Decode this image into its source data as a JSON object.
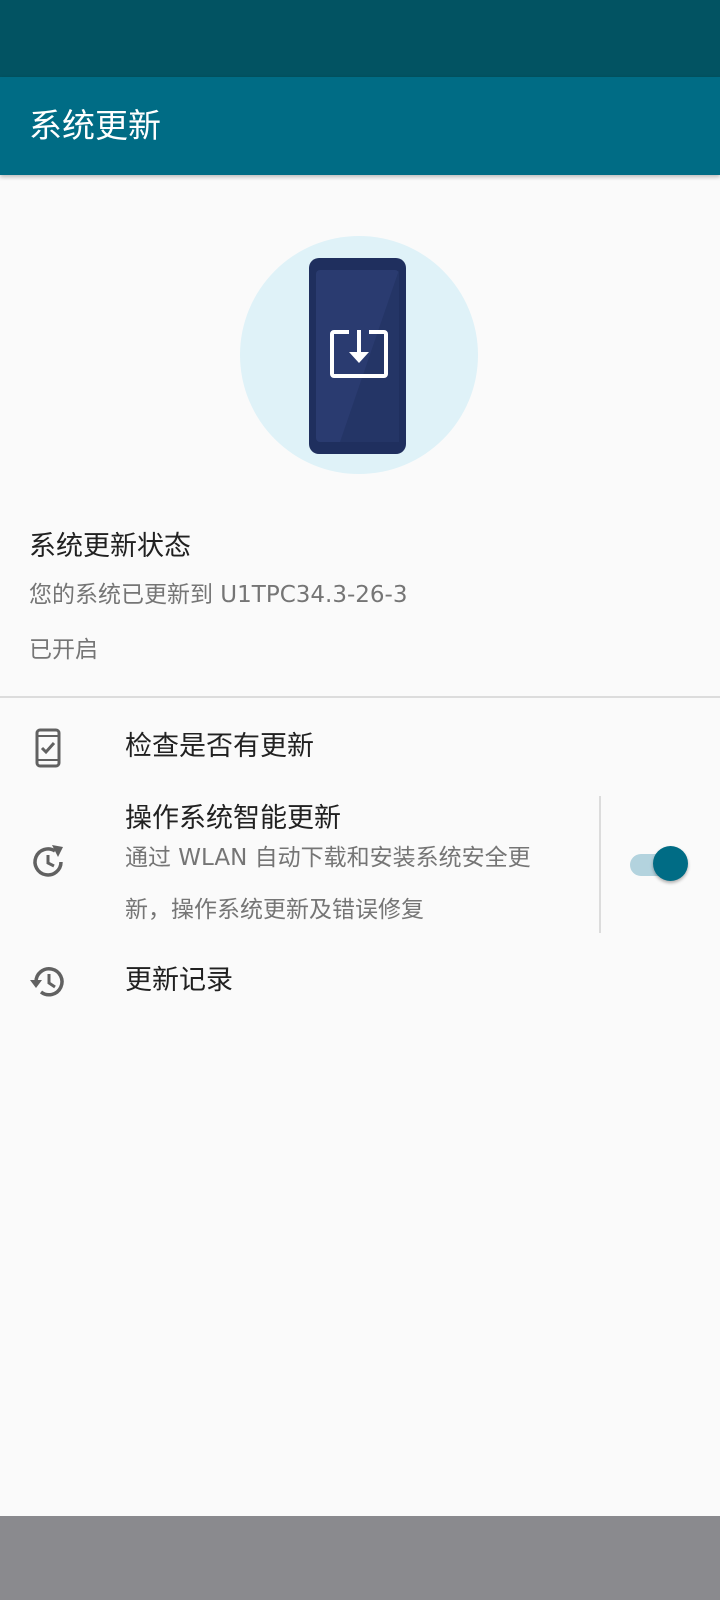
{
  "app_bar": {
    "title": "系统更新"
  },
  "status": {
    "title": "系统更新状态",
    "version_text": "您的系统已更新到 U1TPC34.3-26-3",
    "state_text": "已开启"
  },
  "items": [
    {
      "title": "检查是否有更新",
      "icon": "phone-check-icon"
    },
    {
      "title": "操作系统智能更新",
      "subtitle": "通过 WLAN 自动下载和安装系统安全更新，操作系统更新及错误修复",
      "icon": "clock-refresh-icon",
      "toggle_on": true
    },
    {
      "title": "更新记录",
      "icon": "history-icon"
    }
  ],
  "colors": {
    "status_bar": "#025362",
    "app_bar": "#006c85",
    "accent": "#006c85",
    "hero_circle": "#dff2f8",
    "phone_body": "#1f2f5e"
  }
}
